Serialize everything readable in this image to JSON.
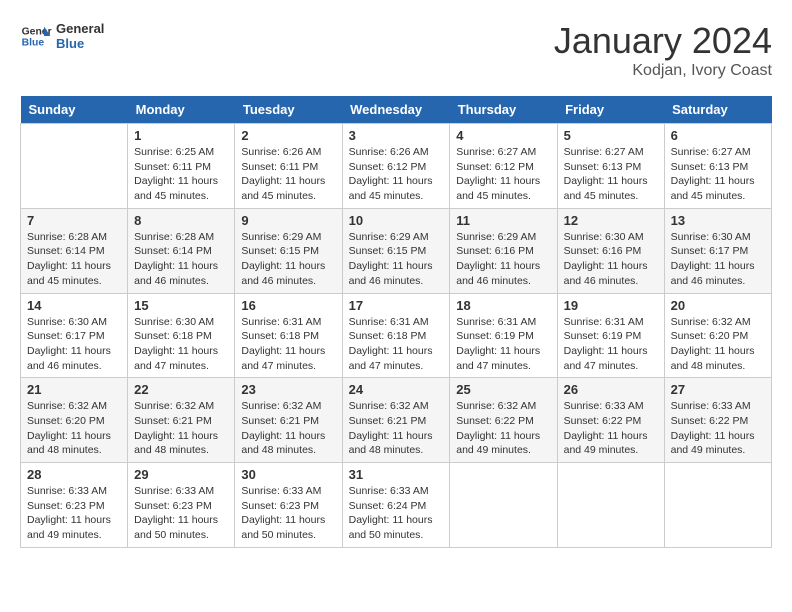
{
  "header": {
    "logo_line1": "General",
    "logo_line2": "Blue",
    "month": "January 2024",
    "location": "Kodjan, Ivory Coast"
  },
  "days_of_week": [
    "Sunday",
    "Monday",
    "Tuesday",
    "Wednesday",
    "Thursday",
    "Friday",
    "Saturday"
  ],
  "weeks": [
    [
      {
        "day": "",
        "info": ""
      },
      {
        "day": "1",
        "info": "Sunrise: 6:25 AM\nSunset: 6:11 PM\nDaylight: 11 hours and 45 minutes."
      },
      {
        "day": "2",
        "info": "Sunrise: 6:26 AM\nSunset: 6:11 PM\nDaylight: 11 hours and 45 minutes."
      },
      {
        "day": "3",
        "info": "Sunrise: 6:26 AM\nSunset: 6:12 PM\nDaylight: 11 hours and 45 minutes."
      },
      {
        "day": "4",
        "info": "Sunrise: 6:27 AM\nSunset: 6:12 PM\nDaylight: 11 hours and 45 minutes."
      },
      {
        "day": "5",
        "info": "Sunrise: 6:27 AM\nSunset: 6:13 PM\nDaylight: 11 hours and 45 minutes."
      },
      {
        "day": "6",
        "info": "Sunrise: 6:27 AM\nSunset: 6:13 PM\nDaylight: 11 hours and 45 minutes."
      }
    ],
    [
      {
        "day": "7",
        "info": "Sunrise: 6:28 AM\nSunset: 6:14 PM\nDaylight: 11 hours and 45 minutes."
      },
      {
        "day": "8",
        "info": "Sunrise: 6:28 AM\nSunset: 6:14 PM\nDaylight: 11 hours and 46 minutes."
      },
      {
        "day": "9",
        "info": "Sunrise: 6:29 AM\nSunset: 6:15 PM\nDaylight: 11 hours and 46 minutes."
      },
      {
        "day": "10",
        "info": "Sunrise: 6:29 AM\nSunset: 6:15 PM\nDaylight: 11 hours and 46 minutes."
      },
      {
        "day": "11",
        "info": "Sunrise: 6:29 AM\nSunset: 6:16 PM\nDaylight: 11 hours and 46 minutes."
      },
      {
        "day": "12",
        "info": "Sunrise: 6:30 AM\nSunset: 6:16 PM\nDaylight: 11 hours and 46 minutes."
      },
      {
        "day": "13",
        "info": "Sunrise: 6:30 AM\nSunset: 6:17 PM\nDaylight: 11 hours and 46 minutes."
      }
    ],
    [
      {
        "day": "14",
        "info": "Sunrise: 6:30 AM\nSunset: 6:17 PM\nDaylight: 11 hours and 46 minutes."
      },
      {
        "day": "15",
        "info": "Sunrise: 6:30 AM\nSunset: 6:18 PM\nDaylight: 11 hours and 47 minutes."
      },
      {
        "day": "16",
        "info": "Sunrise: 6:31 AM\nSunset: 6:18 PM\nDaylight: 11 hours and 47 minutes."
      },
      {
        "day": "17",
        "info": "Sunrise: 6:31 AM\nSunset: 6:18 PM\nDaylight: 11 hours and 47 minutes."
      },
      {
        "day": "18",
        "info": "Sunrise: 6:31 AM\nSunset: 6:19 PM\nDaylight: 11 hours and 47 minutes."
      },
      {
        "day": "19",
        "info": "Sunrise: 6:31 AM\nSunset: 6:19 PM\nDaylight: 11 hours and 47 minutes."
      },
      {
        "day": "20",
        "info": "Sunrise: 6:32 AM\nSunset: 6:20 PM\nDaylight: 11 hours and 48 minutes."
      }
    ],
    [
      {
        "day": "21",
        "info": "Sunrise: 6:32 AM\nSunset: 6:20 PM\nDaylight: 11 hours and 48 minutes."
      },
      {
        "day": "22",
        "info": "Sunrise: 6:32 AM\nSunset: 6:21 PM\nDaylight: 11 hours and 48 minutes."
      },
      {
        "day": "23",
        "info": "Sunrise: 6:32 AM\nSunset: 6:21 PM\nDaylight: 11 hours and 48 minutes."
      },
      {
        "day": "24",
        "info": "Sunrise: 6:32 AM\nSunset: 6:21 PM\nDaylight: 11 hours and 48 minutes."
      },
      {
        "day": "25",
        "info": "Sunrise: 6:32 AM\nSunset: 6:22 PM\nDaylight: 11 hours and 49 minutes."
      },
      {
        "day": "26",
        "info": "Sunrise: 6:33 AM\nSunset: 6:22 PM\nDaylight: 11 hours and 49 minutes."
      },
      {
        "day": "27",
        "info": "Sunrise: 6:33 AM\nSunset: 6:22 PM\nDaylight: 11 hours and 49 minutes."
      }
    ],
    [
      {
        "day": "28",
        "info": "Sunrise: 6:33 AM\nSunset: 6:23 PM\nDaylight: 11 hours and 49 minutes."
      },
      {
        "day": "29",
        "info": "Sunrise: 6:33 AM\nSunset: 6:23 PM\nDaylight: 11 hours and 50 minutes."
      },
      {
        "day": "30",
        "info": "Sunrise: 6:33 AM\nSunset: 6:23 PM\nDaylight: 11 hours and 50 minutes."
      },
      {
        "day": "31",
        "info": "Sunrise: 6:33 AM\nSunset: 6:24 PM\nDaylight: 11 hours and 50 minutes."
      },
      {
        "day": "",
        "info": ""
      },
      {
        "day": "",
        "info": ""
      },
      {
        "day": "",
        "info": ""
      }
    ]
  ]
}
